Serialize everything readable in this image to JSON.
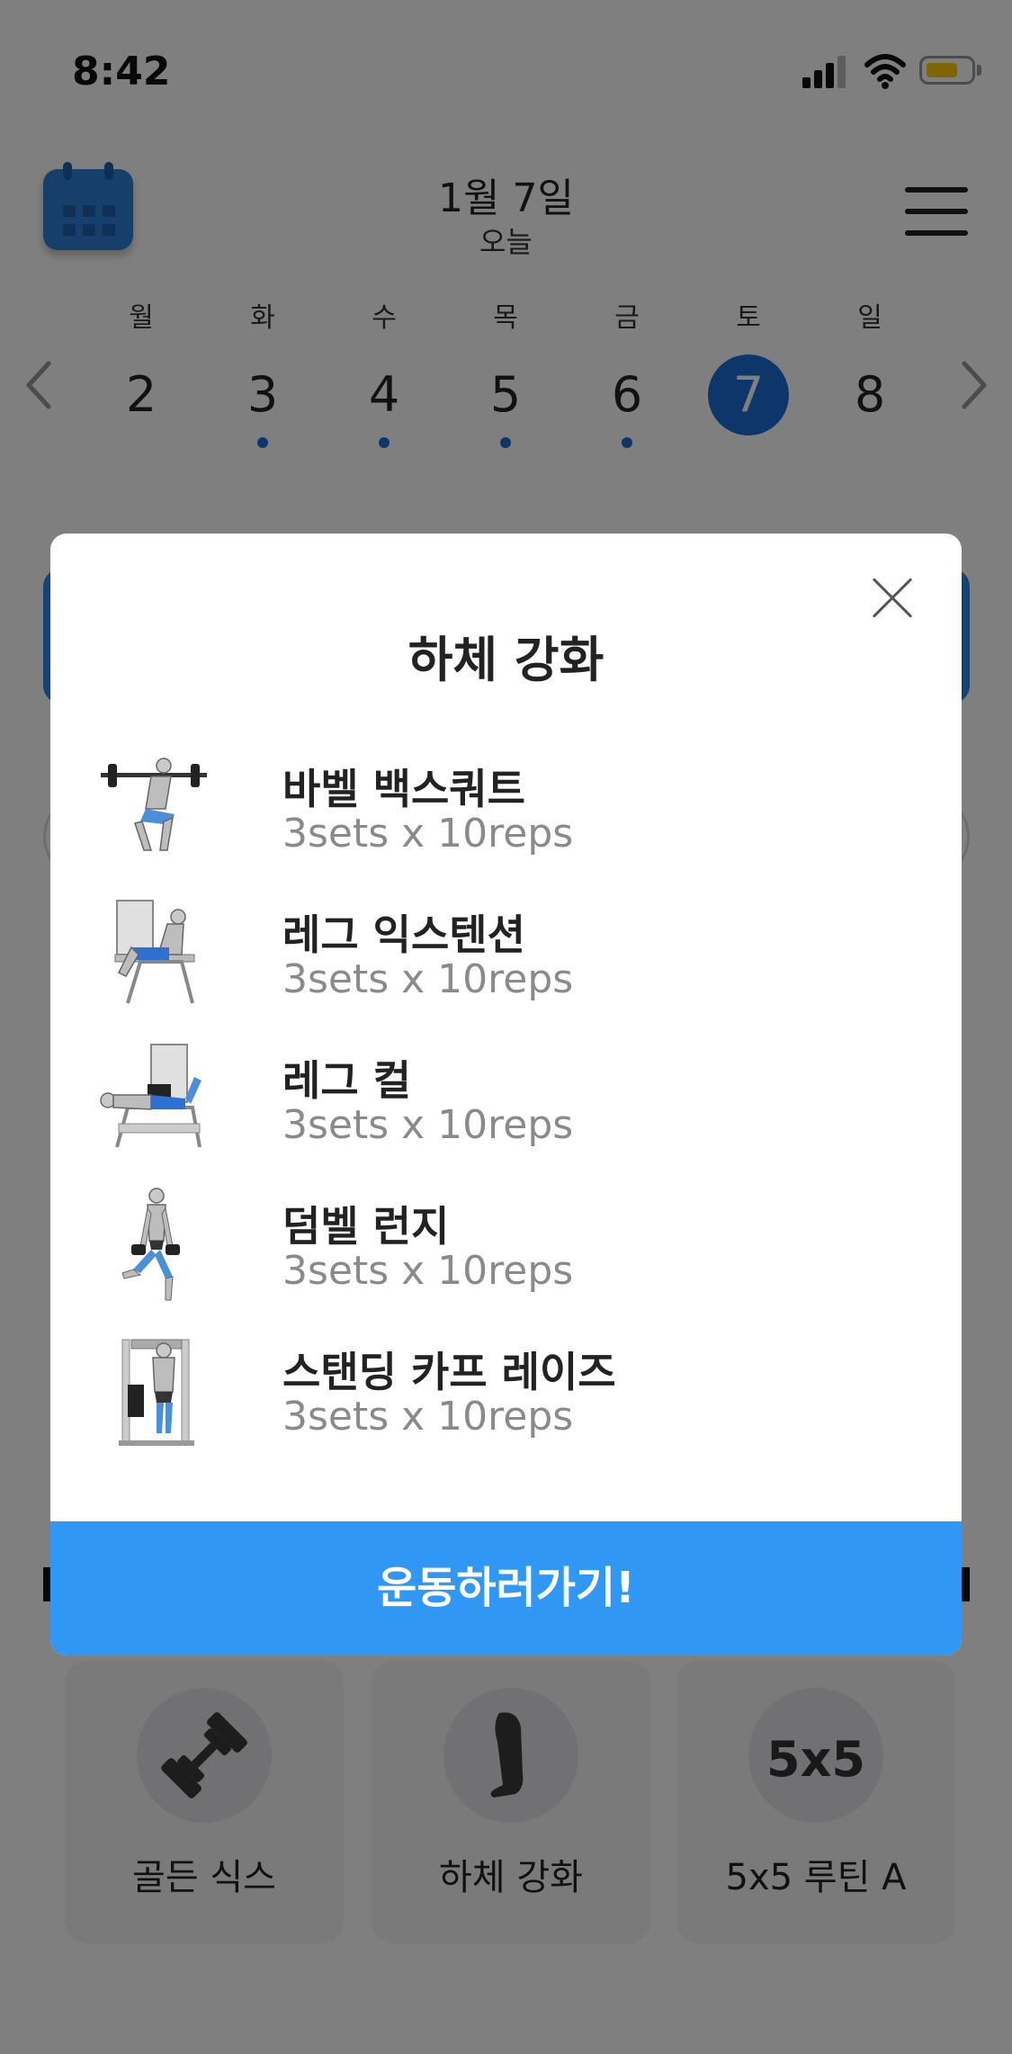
{
  "status_bar": {
    "time": "8:42"
  },
  "header": {
    "calendar_icon": "calendar-icon",
    "date": "1월 7일",
    "subtitle": "오늘",
    "menu_icon": "menu-icon"
  },
  "week": {
    "days": [
      {
        "dow": "월",
        "num": "2",
        "has_workout": false,
        "selected": false
      },
      {
        "dow": "화",
        "num": "3",
        "has_workout": true,
        "selected": false
      },
      {
        "dow": "수",
        "num": "4",
        "has_workout": true,
        "selected": false
      },
      {
        "dow": "목",
        "num": "5",
        "has_workout": true,
        "selected": false
      },
      {
        "dow": "금",
        "num": "6",
        "has_workout": true,
        "selected": false
      },
      {
        "dow": "토",
        "num": "7",
        "has_workout": false,
        "selected": true
      },
      {
        "dow": "일",
        "num": "8",
        "has_workout": false,
        "selected": false
      }
    ],
    "selected_color": "#1a6fd4"
  },
  "routines": [
    {
      "label": "골든 식스",
      "icon": "dumbbell-icon"
    },
    {
      "label": "하체 강화",
      "icon": "leg-icon"
    },
    {
      "label": "5x5 루틴 A",
      "icon_text": "5x5"
    }
  ],
  "modal": {
    "title": "하체 강화",
    "exercises": [
      {
        "name": "바벨 백스쿼트",
        "sets": "3sets x 10reps",
        "thumb": "barbell-squat-illustration"
      },
      {
        "name": "레그 익스텐션",
        "sets": "3sets x 10reps",
        "thumb": "leg-extension-illustration"
      },
      {
        "name": "레그 컬",
        "sets": "3sets x 10reps",
        "thumb": "leg-curl-illustration"
      },
      {
        "name": "덤벨 런지",
        "sets": "3sets x 10reps",
        "thumb": "dumbbell-lunge-illustration"
      },
      {
        "name": "스탠딩 카프 레이즈",
        "sets": "3sets x 10reps",
        "thumb": "standing-calf-raise-illustration"
      }
    ],
    "action_label": "운동하러가기!",
    "action_color": "#3197f5"
  }
}
